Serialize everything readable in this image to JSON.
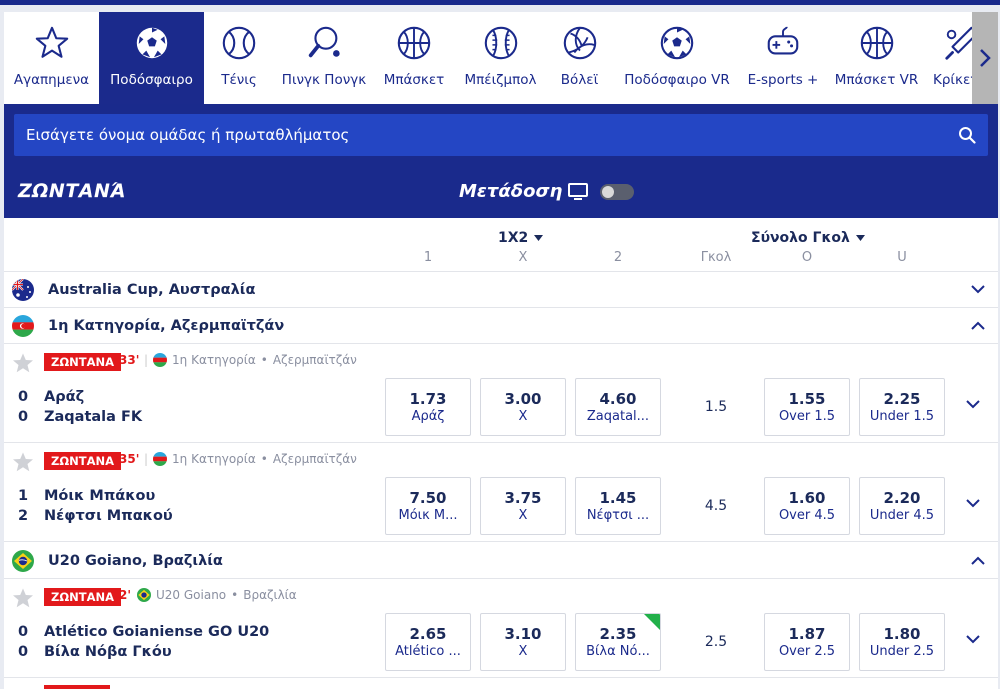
{
  "sports": [
    {
      "label": "Αγαπημενα",
      "icon": "star-icon",
      "active": false
    },
    {
      "label": "Ποδόσφαιρο",
      "icon": "soccer-ball-icon",
      "active": true
    },
    {
      "label": "Τένις",
      "icon": "tennis-ball-icon",
      "active": false
    },
    {
      "label": "Πινγκ Πονγκ",
      "icon": "table-tennis-icon",
      "active": false
    },
    {
      "label": "Μπάσκετ",
      "icon": "basketball-icon",
      "active": false
    },
    {
      "label": "Μπέιζμπολ",
      "icon": "baseball-icon",
      "active": false
    },
    {
      "label": "Βόλεϊ",
      "icon": "volleyball-icon",
      "active": false
    },
    {
      "label": "Ποδόσφαιρο VR",
      "icon": "soccer-ball-icon",
      "active": false
    },
    {
      "label": "E-sports +",
      "icon": "gamepad-icon",
      "active": false
    },
    {
      "label": "Μπάσκετ VR",
      "icon": "basketball-icon",
      "active": false
    },
    {
      "label": "Κρίκετ+",
      "icon": "cricket-icon",
      "active": false
    }
  ],
  "search": {
    "placeholder": "Εισάγετε όνομα ομάδας ή πρωταθλήματος"
  },
  "live": {
    "title": "ΖΩΝΤΑΝΆ",
    "stream_label": "Μετάδοση"
  },
  "columns": {
    "g1_title": "1X2",
    "g1_c1": "1",
    "g1_c2": "X",
    "g1_c3": "2",
    "g2_title": "Σύνολο Γκολ",
    "g2_c1": "Γκολ",
    "g2_c2": "O",
    "g2_c3": "U"
  },
  "leagues": [
    {
      "name": "Australia Cup, Αυστραλία",
      "flag": "australia",
      "expanded": false
    },
    {
      "name": "1η Κατηγορία, Αζερμπαϊτζάν",
      "flag": "azerbaijan",
      "expanded": true
    },
    {
      "name": "U20 Goiano, Βραζιλία",
      "flag": "brazil",
      "expanded": true
    }
  ],
  "matches": [
    {
      "badge": "ΖΩΝΤΑΝΑ",
      "minute": "33'",
      "comp": "1η Κατηγορία",
      "country": "Αζερμπαϊτζάν",
      "flag": "azerbaijan",
      "home": {
        "score": "0",
        "name": "Αράζ"
      },
      "away": {
        "score": "0",
        "name": "Zaqatala FK"
      },
      "odds": [
        {
          "value": "1.73",
          "label": "Αράζ"
        },
        {
          "value": "3.00",
          "label": "X"
        },
        {
          "value": "4.60",
          "label": "Zaqatal..."
        }
      ],
      "line": "1.5",
      "totals": [
        {
          "value": "1.55",
          "label": "Over 1.5"
        },
        {
          "value": "2.25",
          "label": "Under 1.5"
        }
      ]
    },
    {
      "badge": "ΖΩΝΤΑΝΑ",
      "minute": "35'",
      "comp": "1η Κατηγορία",
      "country": "Αζερμπαϊτζάν",
      "flag": "azerbaijan",
      "home": {
        "score": "1",
        "name": "Μόικ Μπάκου"
      },
      "away": {
        "score": "2",
        "name": "Νέφτσι Μπακού"
      },
      "odds": [
        {
          "value": "7.50",
          "label": "Μόικ Μ..."
        },
        {
          "value": "3.75",
          "label": "X"
        },
        {
          "value": "1.45",
          "label": "Νέφτσι ..."
        }
      ],
      "line": "4.5",
      "totals": [
        {
          "value": "1.60",
          "label": "Over 4.5"
        },
        {
          "value": "2.20",
          "label": "Under 4.5"
        }
      ]
    },
    {
      "badge": "ΖΩΝΤΑΝΑ",
      "minute": "2'",
      "comp": "U20 Goiano",
      "country": "Βραζιλία",
      "flag": "brazil",
      "home": {
        "score": "0",
        "name": "Atlético Goianiense GO U20"
      },
      "away": {
        "score": "0",
        "name": "Βίλα Νόβα Γκόυ"
      },
      "odds": [
        {
          "value": "2.65",
          "label": "Atlético ..."
        },
        {
          "value": "3.10",
          "label": "X"
        },
        {
          "value": "2.35",
          "label": "Βίλα Νό...",
          "trend": "up"
        }
      ],
      "line": "2.5",
      "totals": [
        {
          "value": "1.87",
          "label": "Over 2.5"
        },
        {
          "value": "1.80",
          "label": "Under 2.5"
        }
      ]
    }
  ],
  "colors": {
    "brand": "#1a2a8c",
    "search": "#2446c4",
    "live_red": "#e2191b",
    "trend_up": "#22b04a"
  }
}
